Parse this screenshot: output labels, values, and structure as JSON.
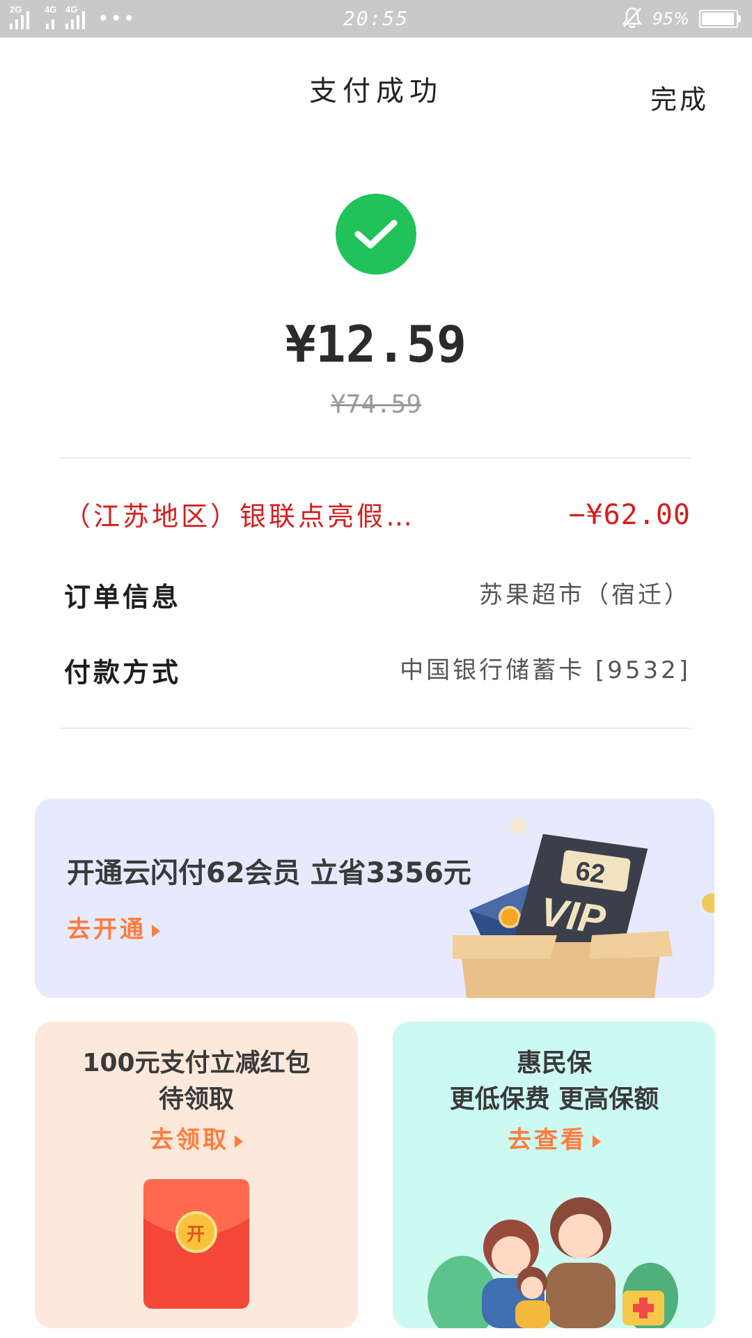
{
  "status_bar": {
    "net1": "2G",
    "net2": "4G",
    "net3": "4G",
    "dots": "•••",
    "time": "20:55",
    "battery": "95%",
    "battery_level": 0.95
  },
  "nav": {
    "title": "支付成功",
    "done": "完成"
  },
  "payment": {
    "amount": "¥12.59",
    "original_amount": "¥74.59"
  },
  "rows": {
    "promo_label": "（江苏地区）银联点亮假…",
    "promo_value": "−¥62.00",
    "order_label": "订单信息",
    "order_value": "苏果超市（宿迁）",
    "pay_label": "付款方式",
    "pay_value": "中国银行储蓄卡 [9532]"
  },
  "vip_card": {
    "title": "开通云闪付62会员 立省3356元",
    "cta": "去开通",
    "badge_number": "62",
    "badge_text": "VIP"
  },
  "hongbao_card": {
    "title_line1": "100元支付立减红包",
    "title_line2": "待领取",
    "cta": "去领取",
    "coin_text": "开"
  },
  "insurance_card": {
    "title_line1": "惠民保",
    "title_line2": "更低保费 更高保额",
    "cta": "去查看"
  },
  "colors": {
    "success_green": "#22c25a",
    "promo_red": "#d51d1d",
    "cta_orange": "#ff7d3c",
    "vip_bg": "#e7eafd",
    "hongbao_bg": "#fde9dc",
    "insurance_bg": "#cdf9f3"
  }
}
